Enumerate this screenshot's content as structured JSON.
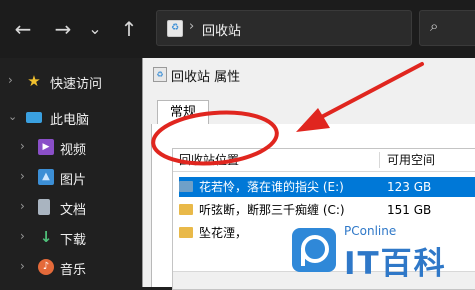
{
  "explorer": {
    "nav": {
      "back_glyph": "←",
      "forward_glyph": "→",
      "down_glyph": "⌄",
      "up_glyph": "↑"
    },
    "address": {
      "path_separator": "›",
      "location": "回收站"
    },
    "search_glyph": "⌕"
  },
  "sidebar": {
    "items": [
      {
        "label": "快速访问",
        "icon": "star-icon",
        "expandable": true
      },
      {
        "label": "此电脑",
        "icon": "computer-icon",
        "expandable": true
      },
      {
        "label": "视频",
        "icon": "video-icon",
        "expandable": true
      },
      {
        "label": "图片",
        "icon": "picture-icon",
        "expandable": true
      },
      {
        "label": "文档",
        "icon": "document-icon",
        "expandable": true
      },
      {
        "label": "下载",
        "icon": "download-icon",
        "expandable": true
      },
      {
        "label": "音乐",
        "icon": "music-icon",
        "expandable": true
      }
    ]
  },
  "dialog": {
    "title": "回收站 属性",
    "tabs": [
      "常规"
    ],
    "list": {
      "columns": [
        "回收站位置",
        "可用空间"
      ],
      "rows": [
        {
          "location": "花若怜，落在谁的指尖 (E:)",
          "free_space": "123 GB",
          "selected": true
        },
        {
          "location": "听弦断，断那三千痴缠 (C:)",
          "free_space": "151 GB",
          "selected": false
        },
        {
          "location": "坠花湮，",
          "free_space": "",
          "selected": false
        }
      ]
    }
  },
  "watermark": {
    "brand": "PConline",
    "name": "IT百科"
  },
  "colors": {
    "explorer_bg": "#202020",
    "selection": "#0078d7",
    "annotation": "#e0261f",
    "watermark": "#2f78c8"
  }
}
